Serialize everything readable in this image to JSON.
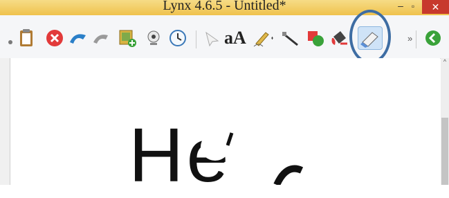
{
  "window": {
    "overlay_title": "Lynx 4.6.5 - Untitled*",
    "caption": "",
    "minimize": "–",
    "maximize": "▫",
    "close": "✕"
  },
  "toolbar": {
    "buttons": [
      {
        "name": "paste",
        "icon": "clipboard-icon"
      },
      {
        "name": "delete",
        "icon": "delete-icon"
      },
      {
        "name": "undo",
        "icon": "undo-icon"
      },
      {
        "name": "redo",
        "icon": "redo-icon"
      },
      {
        "name": "insert-image",
        "icon": "image-add-icon"
      },
      {
        "name": "camera",
        "icon": "webcam-icon"
      },
      {
        "name": "timer",
        "icon": "clock-icon"
      },
      {
        "name": "select",
        "icon": "pointer-icon"
      },
      {
        "name": "text",
        "icon": "text-icon"
      },
      {
        "name": "pen",
        "icon": "pen-icon"
      },
      {
        "name": "line",
        "icon": "line-icon"
      },
      {
        "name": "shapes",
        "icon": "shapes-icon"
      },
      {
        "name": "fill",
        "icon": "paint-bucket-icon"
      },
      {
        "name": "eraser",
        "icon": "eraser-icon"
      },
      {
        "name": "next",
        "icon": "arrow-left-icon"
      }
    ],
    "overflow_glyph": "»",
    "text_tool_glyph": "aA"
  },
  "canvas": {
    "text": "He"
  }
}
